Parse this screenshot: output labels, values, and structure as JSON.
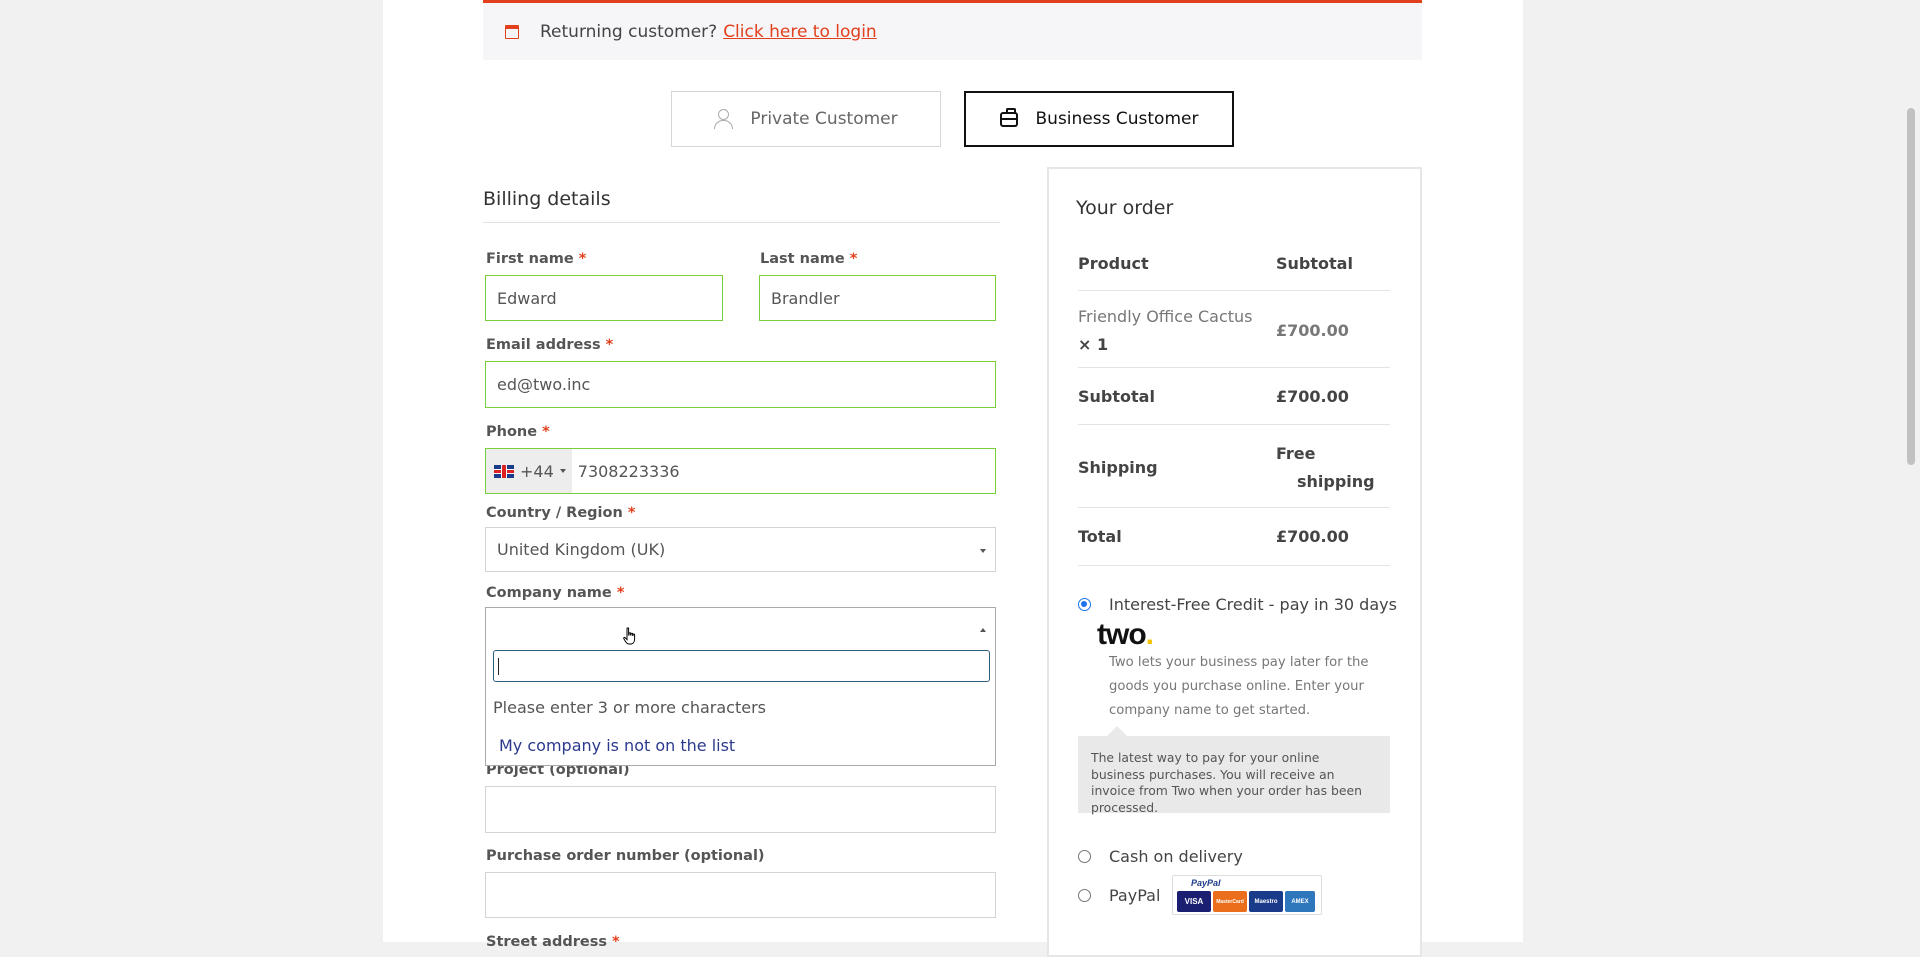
{
  "notice": {
    "text": "Returning customer?",
    "link": "Click here to login"
  },
  "customer_type": {
    "private": "Private Customer",
    "business": "Business Customer"
  },
  "billing": {
    "title": "Billing details",
    "first_name": {
      "label": "First name",
      "value": "Edward"
    },
    "last_name": {
      "label": "Last name",
      "value": "Brandler"
    },
    "email": {
      "label": "Email address",
      "value": "ed@two.inc"
    },
    "phone": {
      "label": "Phone",
      "dial_code": "+44",
      "value": "7308223336"
    },
    "country": {
      "label": "Country / Region",
      "value": "United Kingdom (UK)"
    },
    "company": {
      "label": "Company name",
      "search_value": "",
      "message": "Please enter 3 or more characters",
      "not_listed": "My company is not on the list"
    },
    "project": {
      "label": "Project (optional)",
      "value": ""
    },
    "po_number": {
      "label": "Purchase order number (optional)",
      "value": ""
    },
    "street": {
      "label": "Street address"
    },
    "required_mark": "*"
  },
  "order": {
    "title": "Your order",
    "headers": {
      "product": "Product",
      "subtotal": "Subtotal"
    },
    "item": {
      "name": "Friendly Office Cactus",
      "qty": "× 1",
      "price": "£700.00"
    },
    "subtotal": {
      "label": "Subtotal",
      "value": "£700.00"
    },
    "shipping": {
      "label": "Shipping",
      "value_line1": "Free",
      "value_line2": "shipping"
    },
    "total": {
      "label": "Total",
      "value": "£700.00"
    }
  },
  "payment": {
    "credit": {
      "label": "Interest-Free Credit - pay in 30 days",
      "logo_text": "two",
      "description": "Two lets your business pay later for the goods you purchase online. Enter your company name to get started.",
      "box": "The latest way to pay for your online business purchases. You will receive an invoice from Two when your order has been processed.",
      "selected": true
    },
    "cod": {
      "label": "Cash on delivery"
    },
    "paypal": {
      "label": "PayPal",
      "brand_text": "PayPal",
      "cards": [
        "VISA",
        "MasterCard",
        "Maestro",
        "AMEX"
      ]
    }
  },
  "colors": {
    "accent": "#e2401c",
    "valid": "#7ad03a",
    "link": "#2c3a8e",
    "radio": "#1a73e8"
  }
}
